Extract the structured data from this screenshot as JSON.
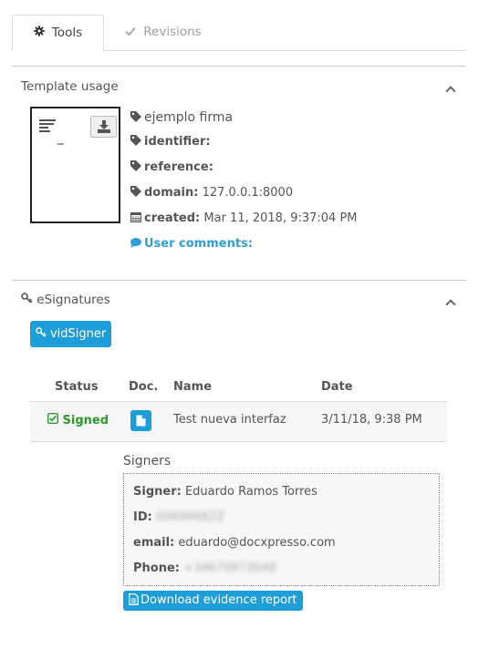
{
  "tabs": [
    {
      "label": "Tools",
      "icon": "gear-icon",
      "active": true
    },
    {
      "label": "Revisions",
      "icon": "check-icon",
      "active": false
    }
  ],
  "template_usage": {
    "title": "Template usage",
    "thumbnail_icon": "download-icon",
    "name": "ejemplo firma",
    "identifier_label": "identifier:",
    "identifier_value": "",
    "reference_label": "reference:",
    "reference_value": "",
    "domain_label": "domain:",
    "domain_value": "127.0.0.1:8000",
    "created_label": "created:",
    "created_value": "Mar 11, 2018, 9:37:04 PM",
    "user_comments_label": "User comments:"
  },
  "esignatures": {
    "title": "eSignatures",
    "provider_button": "vidSigner",
    "table": {
      "headers": [
        "Status",
        "Doc.",
        "Name",
        "Date"
      ],
      "rows": [
        {
          "status": "Signed",
          "doc_icon": "file-icon",
          "name": "Test nueva interfaz",
          "date": "3/11/18, 9:38 PM"
        }
      ]
    },
    "signers": {
      "title": "Signers",
      "signer_label": "Signer:",
      "signer_value": "Eduardo Ramos Torres",
      "id_label": "ID:",
      "id_value": "00699682Z",
      "email_label": "email:",
      "email_value": "eduardo@docxpresso.com",
      "phone_label": "Phone:",
      "phone_value": "+34670973048"
    },
    "download_button": "Download evidence report"
  },
  "colors": {
    "accent": "#1e9ed9",
    "signed": "#2a9a2a",
    "link": "#2e9fd6"
  }
}
